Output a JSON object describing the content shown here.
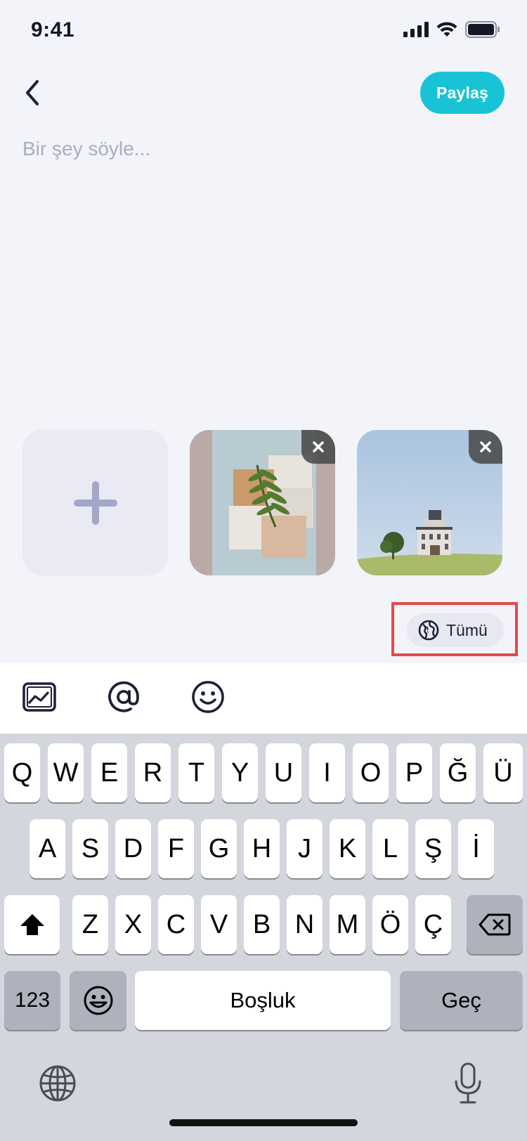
{
  "status_bar": {
    "time": "9:41"
  },
  "header": {
    "share_label": "Paylaş"
  },
  "composer": {
    "placeholder": "Bir şey söyle..."
  },
  "media": {
    "add_icon": "plus-icon",
    "photos": [
      {
        "subject": "tiles-with-fern-leaf",
        "remove_icon": "close-icon"
      },
      {
        "subject": "house-on-hill-with-tree",
        "remove_icon": "close-icon"
      }
    ]
  },
  "audience": {
    "label": "Tümü",
    "icon": "globe-icon"
  },
  "toolbar": {
    "items": [
      "gallery-icon",
      "mention-at-icon",
      "emoji-smile-icon"
    ]
  },
  "keyboard": {
    "row1": [
      "Q",
      "W",
      "E",
      "R",
      "T",
      "Y",
      "U",
      "I",
      "O",
      "P",
      "Ğ",
      "Ü"
    ],
    "row2": [
      "A",
      "S",
      "D",
      "F",
      "G",
      "H",
      "J",
      "K",
      "L",
      "Ş",
      "İ"
    ],
    "row3": [
      "Z",
      "X",
      "C",
      "V",
      "B",
      "N",
      "M",
      "Ö",
      "Ç"
    ],
    "numbers_label": "123",
    "space_label": "Boşluk",
    "return_label": "Geç"
  },
  "colors": {
    "accent": "#19c3d6",
    "background": "#f3f4f9",
    "highlight": "#e24a4a"
  }
}
